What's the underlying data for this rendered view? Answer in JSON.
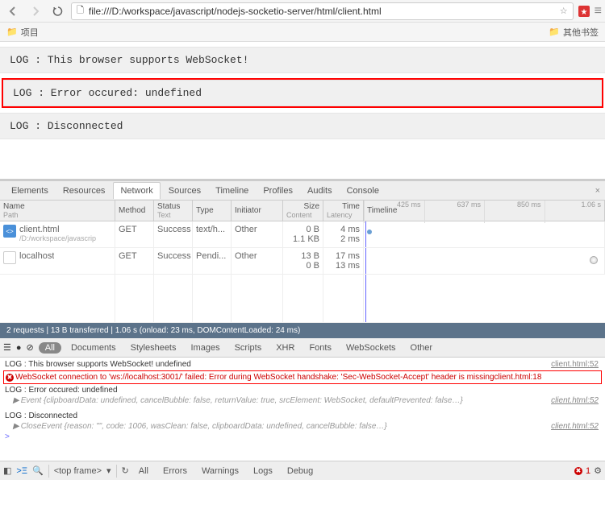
{
  "toolbar": {
    "url": "file:///D:/workspace/javascript/nodejs-socketio-server/html/client.html"
  },
  "bookmarks": {
    "item1": "项目",
    "other": "其他书签"
  },
  "logs": {
    "l1": "LOG : This browser supports WebSocket!",
    "l2": "LOG : Error occured: undefined",
    "l3": "LOG : Disconnected"
  },
  "devtools": {
    "tabs": [
      "Elements",
      "Resources",
      "Network",
      "Sources",
      "Timeline",
      "Profiles",
      "Audits",
      "Console"
    ],
    "active_tab": 2,
    "net_headers": {
      "name": "Name",
      "name_sub": "Path",
      "method": "Method",
      "status": "Status",
      "status_sub": "Text",
      "type": "Type",
      "initiator": "Initiator",
      "size": "Size",
      "size_sub": "Content",
      "time": "Time",
      "time_sub": "Latency",
      "timeline": "Timeline",
      "ticks": [
        "425 ms",
        "637 ms",
        "850 ms",
        "1.06 s"
      ]
    },
    "requests": [
      {
        "name": "client.html",
        "path": "/D:/workspace/javascrip",
        "method": "GET",
        "status": "Success",
        "type": "text/h...",
        "initiator": "Other",
        "size": "0 B",
        "content": "1.1 KB",
        "time": "4 ms",
        "latency": "2 ms"
      },
      {
        "name": "localhost",
        "path": "",
        "method": "GET",
        "status": "Success",
        "type": "Pendi...",
        "initiator": "Other",
        "size": "13 B",
        "content": "0 B",
        "time": "17 ms",
        "latency": "13 ms"
      }
    ],
    "summary": "2 requests  |  13 B transferred  |  1.06 s (onload: 23 ms, DOMContentLoaded: 24 ms)",
    "filters": [
      "All",
      "Documents",
      "Stylesheets",
      "Images",
      "Scripts",
      "XHR",
      "Fonts",
      "WebSockets",
      "Other"
    ],
    "console": {
      "l1": "LOG : This browser supports WebSocket! undefined",
      "l1_src": "client.html:52",
      "err": "WebSocket connection to 'ws://localhost:3001/' failed: Error during WebSocket handshake: 'Sec-WebSocket-Accept' header is missing",
      "err_src": "client.html:18",
      "l2": "LOG : Error occured: undefined",
      "l2_sub": "Event {clipboardData: undefined, cancelBubble: false, returnValue: true, srcElement: WebSocket, defaultPrevented: false…}",
      "l2_src": "client.html:52",
      "l3": "LOG : Disconnected",
      "l3_sub": "CloseEvent {reason: \"\", code: 1006, wasClean: false, clipboardData: undefined, cancelBubble: false…}",
      "l3_src": "client.html:52"
    },
    "bottom": {
      "frame": "<top frame>",
      "items": [
        "All",
        "Errors",
        "Warnings",
        "Logs",
        "Debug"
      ],
      "err_count": "1"
    }
  }
}
